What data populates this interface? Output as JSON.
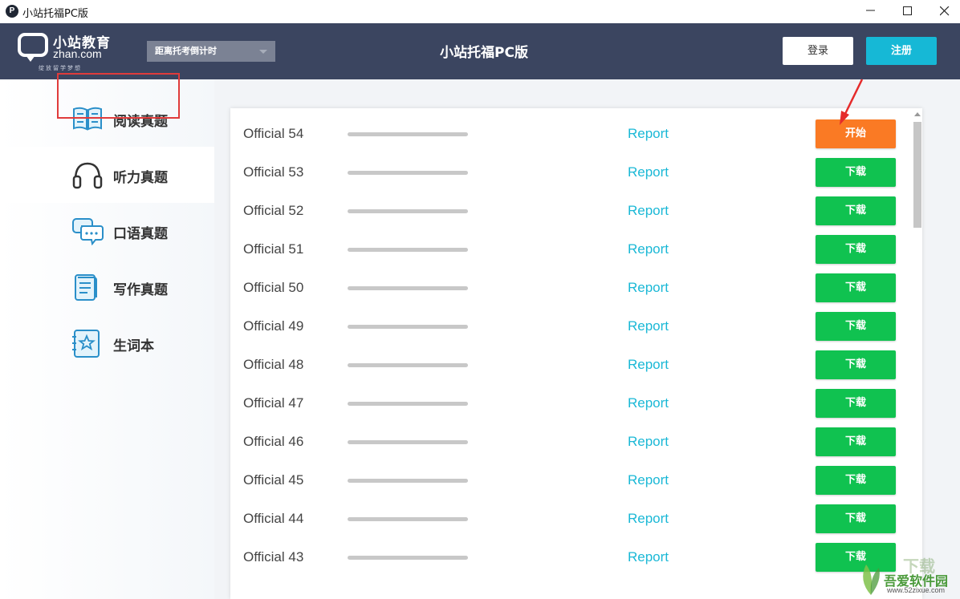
{
  "window": {
    "title": "小站托福PC版"
  },
  "header": {
    "logo_cn": "小站教育",
    "logo_en": "zhan.com",
    "logo_slogan": "绽放留学梦想",
    "countdown_label": "距离托考倒计时",
    "title": "小站托福PC版",
    "login_label": "登录",
    "register_label": "注册",
    "accent_color": "#16b8d6"
  },
  "sidebar": {
    "items": [
      {
        "label": "阅读真题",
        "icon": "book-icon"
      },
      {
        "label": "听力真题",
        "icon": "headphones-icon",
        "active": true
      },
      {
        "label": "口语真题",
        "icon": "chat-bubbles-icon"
      },
      {
        "label": "写作真题",
        "icon": "document-icon"
      },
      {
        "label": "生词本",
        "icon": "star-notebook-icon"
      }
    ]
  },
  "tests": [
    {
      "name": "Official 54",
      "report": "Report",
      "action": "开始",
      "status": "start"
    },
    {
      "name": "Official 53",
      "report": "Report",
      "action": "下载",
      "status": "download"
    },
    {
      "name": "Official 52",
      "report": "Report",
      "action": "下载",
      "status": "download"
    },
    {
      "name": "Official 51",
      "report": "Report",
      "action": "下载",
      "status": "download"
    },
    {
      "name": "Official 50",
      "report": "Report",
      "action": "下载",
      "status": "download"
    },
    {
      "name": "Official 49",
      "report": "Report",
      "action": "下载",
      "status": "download"
    },
    {
      "name": "Official 48",
      "report": "Report",
      "action": "下载",
      "status": "download"
    },
    {
      "name": "Official 47",
      "report": "Report",
      "action": "下载",
      "status": "download"
    },
    {
      "name": "Official 46",
      "report": "Report",
      "action": "下载",
      "status": "download"
    },
    {
      "name": "Official 45",
      "report": "Report",
      "action": "下载",
      "status": "download"
    },
    {
      "name": "Official 44",
      "report": "Report",
      "action": "下载",
      "status": "download"
    },
    {
      "name": "Official 43",
      "report": "Report",
      "action": "下载",
      "status": "download"
    }
  ],
  "watermark": {
    "cn": "吾爱软件园",
    "url": "www.52zixue.com",
    "xz": "下载"
  },
  "colors": {
    "start": "#fa7a24",
    "download": "#10c250",
    "report": "#1ab8d6",
    "header_bg": "#3b4560"
  }
}
